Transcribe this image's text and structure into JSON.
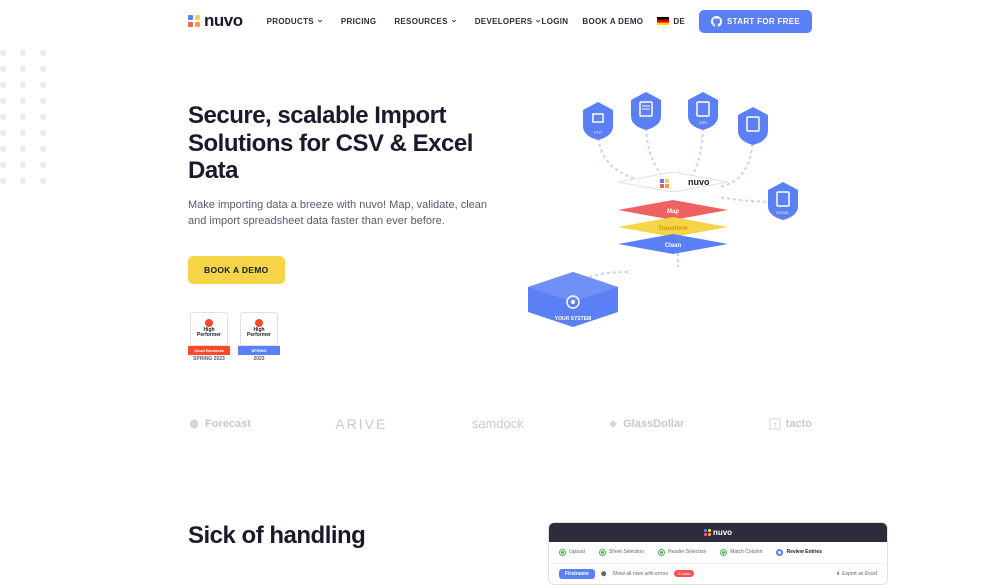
{
  "header": {
    "brand": "nuvo",
    "nav": [
      {
        "label": "PRODUCTS",
        "hasDropdown": true
      },
      {
        "label": "PRICING",
        "hasDropdown": false
      },
      {
        "label": "RESOURCES",
        "hasDropdown": true
      },
      {
        "label": "DEVELOPERS",
        "hasDropdown": true
      }
    ],
    "login": "LOGIN",
    "bookDemo": "BOOK A DEMO",
    "lang": "DE",
    "cta": "START FOR FREE"
  },
  "hero": {
    "title": "Secure, scalable Import Solutions for CSV & Excel Data",
    "subtitle": "Make importing data a breeze with nuvo! Map, validate, clean and import spreadsheet data faster than ever before.",
    "demoBtn": "BOOK A DEMO",
    "badges": [
      {
        "label": "High\nPerformer",
        "band": "Small Business",
        "year": "SPRING 2023",
        "bandColor": "red"
      },
      {
        "label": "High\nPerformer",
        "band": "SPRING",
        "year": "2023",
        "bandColor": "blue"
      }
    ]
  },
  "logos": [
    "Forecast",
    "ARIVE",
    "samdock",
    "GlassDollar",
    "tacto"
  ],
  "section2": {
    "title": "Sick of handling"
  },
  "mockApp": {
    "brand": "nuvo",
    "steps": [
      "Upload",
      "Sheet Selection",
      "Header Selection",
      "Match Column",
      "Review Entries"
    ],
    "pill": "Firstname",
    "toggleLabel": "Show all rows with errors",
    "errorCount": "3 rows",
    "export": "Export as Excel"
  },
  "colors": {
    "blue": "#5b7ff5",
    "yellow": "#f5d547",
    "red": "#f06262",
    "orange": "#ff9d4d"
  }
}
